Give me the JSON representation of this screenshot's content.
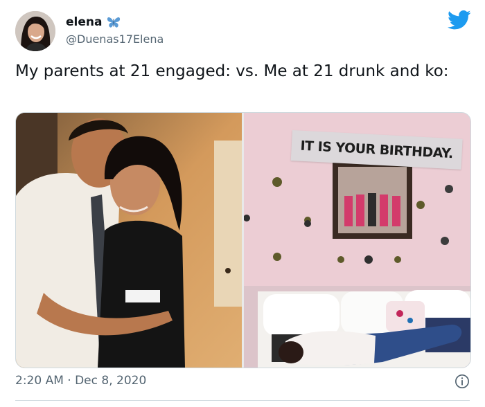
{
  "author": {
    "display_name": "elena",
    "handle": "@Duenas17Elena",
    "badge_icon": "butterfly-icon"
  },
  "tweet": {
    "text": "My parents at 21 engaged: vs. Me at 21 drunk and ko:",
    "timestamp": "2:20 AM · Dec 8, 2020"
  },
  "media": {
    "right_photo_banner": "IT IS YOUR BIRTHDAY."
  },
  "colors": {
    "twitter_blue": "#1d9bf0",
    "secondary_text": "#536471"
  },
  "icons": [
    "twitter-bird-icon",
    "butterfly-icon",
    "info-icon"
  ]
}
